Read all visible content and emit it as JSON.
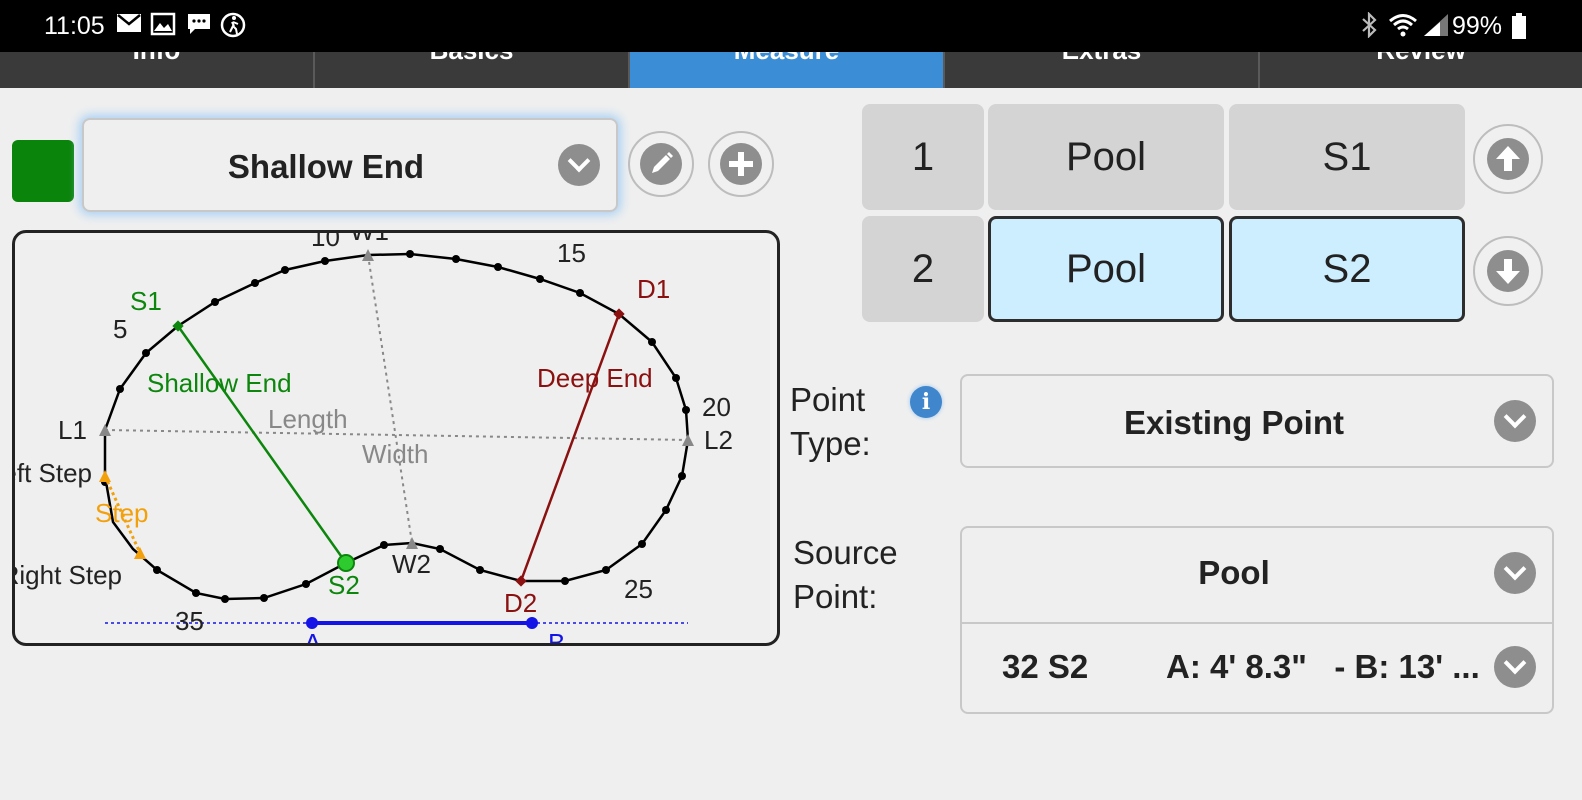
{
  "status_bar": {
    "time": "11:05",
    "battery": "99%"
  },
  "tabs": [
    {
      "label": "Info",
      "active": false
    },
    {
      "label": "Basics",
      "active": false
    },
    {
      "label": "Measure",
      "active": true
    },
    {
      "label": "Extras",
      "active": false
    },
    {
      "label": "Review",
      "active": false
    }
  ],
  "section": {
    "selected": "Shallow End",
    "swatch_color": "#0a840a"
  },
  "diagram": {
    "labels": {
      "s1": "S1",
      "s2": "S2",
      "d1": "D1",
      "d2": "D2",
      "l1": "L1",
      "l2": "L2",
      "w1": "W1",
      "w2": "W2",
      "n5": "5",
      "n10": "10",
      "n15": "15",
      "n20": "20",
      "n25": "25",
      "n35": "35",
      "shallow_end": "Shallow End",
      "deep_end": "Deep End",
      "length": "Length",
      "width": "Width",
      "step": "Step",
      "left_step": "Left Step",
      "right_step": "Right Step",
      "a": "A",
      "b": "B"
    }
  },
  "measure_table": [
    {
      "index": "1",
      "source": "Pool",
      "point": "S1",
      "selected": false
    },
    {
      "index": "2",
      "source": "Pool",
      "point": "S2",
      "selected": true
    }
  ],
  "point_type": {
    "label": "Point Type:",
    "value": "Existing Point"
  },
  "source_point": {
    "label": "Source Point:",
    "source": "Pool",
    "point_name": "32 S2",
    "point_detail": "A: 4' 8.3\"   - B: 13' ..."
  }
}
